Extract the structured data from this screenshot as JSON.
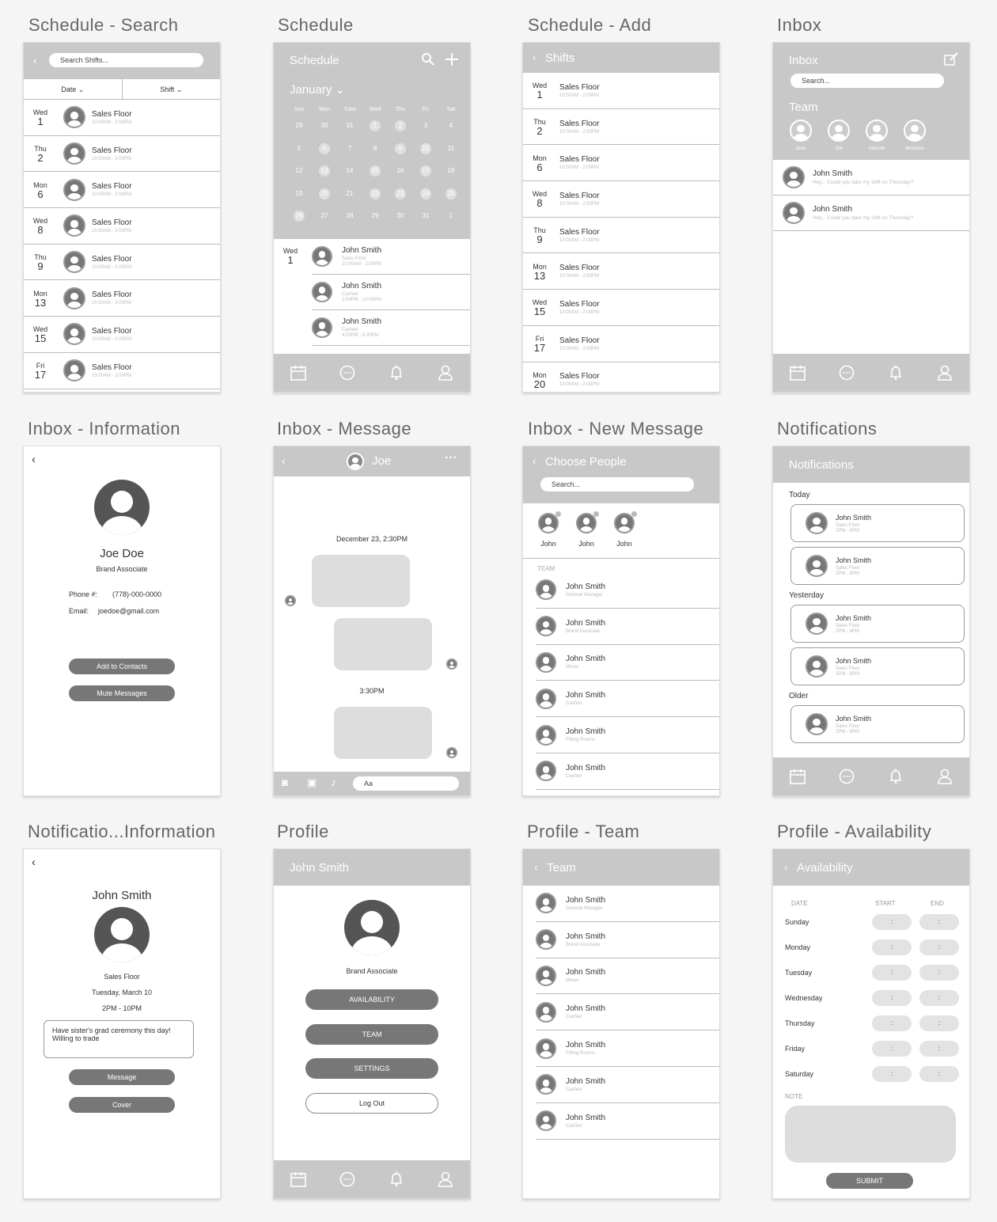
{
  "screens": {
    "s1": {
      "title": "Schedule - Search",
      "search": "Search Shifts...",
      "filters": [
        "Date",
        "Shift"
      ],
      "rows": [
        {
          "dow": "Wed",
          "d": "1",
          "t": "Sales Floor",
          "s": "10:00AM - 2:00PM"
        },
        {
          "dow": "Thu",
          "d": "2",
          "t": "Sales Floor",
          "s": "10:00AM - 2:00PM"
        },
        {
          "dow": "Mon",
          "d": "6",
          "t": "Sales Floor",
          "s": "10:00AM - 2:00PM"
        },
        {
          "dow": "Wed",
          "d": "8",
          "t": "Sales Floor",
          "s": "10:00AM - 2:00PM"
        },
        {
          "dow": "Thu",
          "d": "9",
          "t": "Sales Floor",
          "s": "10:00AM - 2:00PM"
        },
        {
          "dow": "Mon",
          "d": "13",
          "t": "Sales Floor",
          "s": "10:00AM - 2:00PM"
        },
        {
          "dow": "Wed",
          "d": "15",
          "t": "Sales Floor",
          "s": "10:00AM - 2:00PM"
        },
        {
          "dow": "Fri",
          "d": "17",
          "t": "Sales Floor",
          "s": "10:00AM - 2:00PM"
        }
      ]
    },
    "s2": {
      "title": "Schedule",
      "header": "Schedule",
      "month": "January",
      "weekdays": [
        "Sun",
        "Mon",
        "Tues",
        "Wed",
        "Thu",
        "Fri",
        "Sat"
      ],
      "days": [
        "29",
        "30",
        "31",
        "1",
        "2",
        "3",
        "4",
        "5",
        "6",
        "7",
        "8",
        "9",
        "10",
        "11",
        "12",
        "13",
        "14",
        "15",
        "16",
        "17",
        "18",
        "19",
        "20",
        "21",
        "22",
        "23",
        "24",
        "25",
        "26",
        "27",
        "28",
        "29",
        "30",
        "31",
        "1"
      ],
      "marked": [
        3,
        4,
        8,
        11,
        12,
        15,
        17,
        19,
        22,
        24,
        25,
        26,
        27,
        28
      ],
      "dow": "Wed",
      "d": "1",
      "shifts": [
        {
          "n": "John Smith",
          "r": "Sales Floor",
          "s": "10:00AM - 2:00PM"
        },
        {
          "n": "John Smith",
          "r": "Cashier",
          "s": "2:00PM - 10:00PM"
        },
        {
          "n": "John Smith",
          "r": "Cashier",
          "s": "4:00PM - 8:00PM"
        }
      ]
    },
    "s3": {
      "title": "Schedule - Add",
      "header": "Shifts",
      "rows": [
        {
          "dow": "Wed",
          "d": "1",
          "t": "Sales Floor",
          "s": "10:00AM - 2:00PM"
        },
        {
          "dow": "Thu",
          "d": "2",
          "t": "Sales Floor",
          "s": "10:00AM - 2:00PM"
        },
        {
          "dow": "Mon",
          "d": "6",
          "t": "Sales Floor",
          "s": "10:00AM - 2:00PM"
        },
        {
          "dow": "Wed",
          "d": "8",
          "t": "Sales Floor",
          "s": "10:00AM - 2:00PM"
        },
        {
          "dow": "Thu",
          "d": "9",
          "t": "Sales Floor",
          "s": "10:00AM - 2:00PM"
        },
        {
          "dow": "Mon",
          "d": "13",
          "t": "Sales Floor",
          "s": "10:00AM - 2:00PM"
        },
        {
          "dow": "Wed",
          "d": "15",
          "t": "Sales Floor",
          "s": "10:00AM - 2:00PM"
        },
        {
          "dow": "Fri",
          "d": "17",
          "t": "Sales Floor",
          "s": "10:00AM - 2:00PM"
        },
        {
          "dow": "Mon",
          "d": "20",
          "t": "Sales Floor",
          "s": "10:00AM - 2:00PM"
        }
      ]
    },
    "s4": {
      "title": "Inbox",
      "header": "Inbox",
      "search": "Search...",
      "team_label": "Team",
      "team": [
        "Jane",
        "Joe",
        "Hannah",
        "Montana"
      ],
      "msgs": [
        {
          "n": "John Smith",
          "m": "Hey... Could you take my shift on Thursday?"
        },
        {
          "n": "John Smith",
          "m": "Hey... Could you take my shift on Thursday?"
        }
      ]
    },
    "s5": {
      "title": "Inbox - Information",
      "name": "Joe Doe",
      "role": "Brand Associate",
      "phone_label": "Phone #:",
      "phone": "(778)-000-0000",
      "email_label": "Email:",
      "email": "joedoe@gmail.com",
      "btn1": "Add to Contacts",
      "btn2": "Mute Messages"
    },
    "s6": {
      "title": "Inbox - Message",
      "header": "Joe",
      "ts1": "December 23, 2:30PM",
      "ts2": "3:30PM",
      "input": "Aa"
    },
    "s7": {
      "title": "Inbox - New Message",
      "header": "Choose People",
      "search": "Search...",
      "chosen": [
        "John",
        "John",
        "John"
      ],
      "team_label": "TEAM",
      "people": [
        {
          "n": "John Smith",
          "r": "General Manager"
        },
        {
          "n": "John Smith",
          "r": "Brand Associate"
        },
        {
          "n": "John Smith",
          "r": "Mover"
        },
        {
          "n": "John Smith",
          "r": "Cashier"
        },
        {
          "n": "John Smith",
          "r": "Fitting Rooms"
        },
        {
          "n": "John Smith",
          "r": "Cashier"
        }
      ]
    },
    "s8": {
      "title": "Notifications",
      "header": "Notifications",
      "today": "Today",
      "yesterday": "Yesterday",
      "older": "Older",
      "card": {
        "n": "John Smith",
        "r": "Sales Floor",
        "s": "2PM - 8PM"
      }
    },
    "s9": {
      "title": "Notificatio...Information",
      "name": "John Smith",
      "role": "Sales Floor",
      "date": "Tuesday, March 10",
      "time": "2PM - 10PM",
      "note": "Have sister's grad ceremony this day! Willing to trade",
      "btn1": "Message",
      "btn2": "Cover"
    },
    "s10": {
      "title": "Profile",
      "header": "John Smith",
      "role": "Brand Associate",
      "btn1": "AVAILABILITY",
      "btn2": "TEAM",
      "btn3": "SETTINGS",
      "btn4": "Log Out"
    },
    "s11": {
      "title": "Profile - Team",
      "header": "Team",
      "people": [
        {
          "n": "John Smith",
          "r": "General Manager"
        },
        {
          "n": "John Smith",
          "r": "Brand Associate"
        },
        {
          "n": "John Smith",
          "r": "Mover"
        },
        {
          "n": "John Smith",
          "r": "Cashier"
        },
        {
          "n": "John Smith",
          "r": "Fitting Rooms"
        },
        {
          "n": "John Smith",
          "r": "Cashier"
        },
        {
          "n": "John Smith",
          "r": "Cashier"
        }
      ]
    },
    "s12": {
      "title": "Profile - Availability",
      "header": "Availability",
      "col_date": "DATE",
      "col_start": "START",
      "col_end": "END",
      "days": [
        "Sunday",
        "Monday",
        "Tuesday",
        "Wednesday",
        "Thursday",
        "Friday",
        "Saturday"
      ],
      "time_placeholder": ":",
      "note_label": "NOTE",
      "submit": "SUBMIT"
    }
  },
  "colors": {
    "header": "#c8c8c8",
    "button": "#777777",
    "avatar": "#777777"
  }
}
